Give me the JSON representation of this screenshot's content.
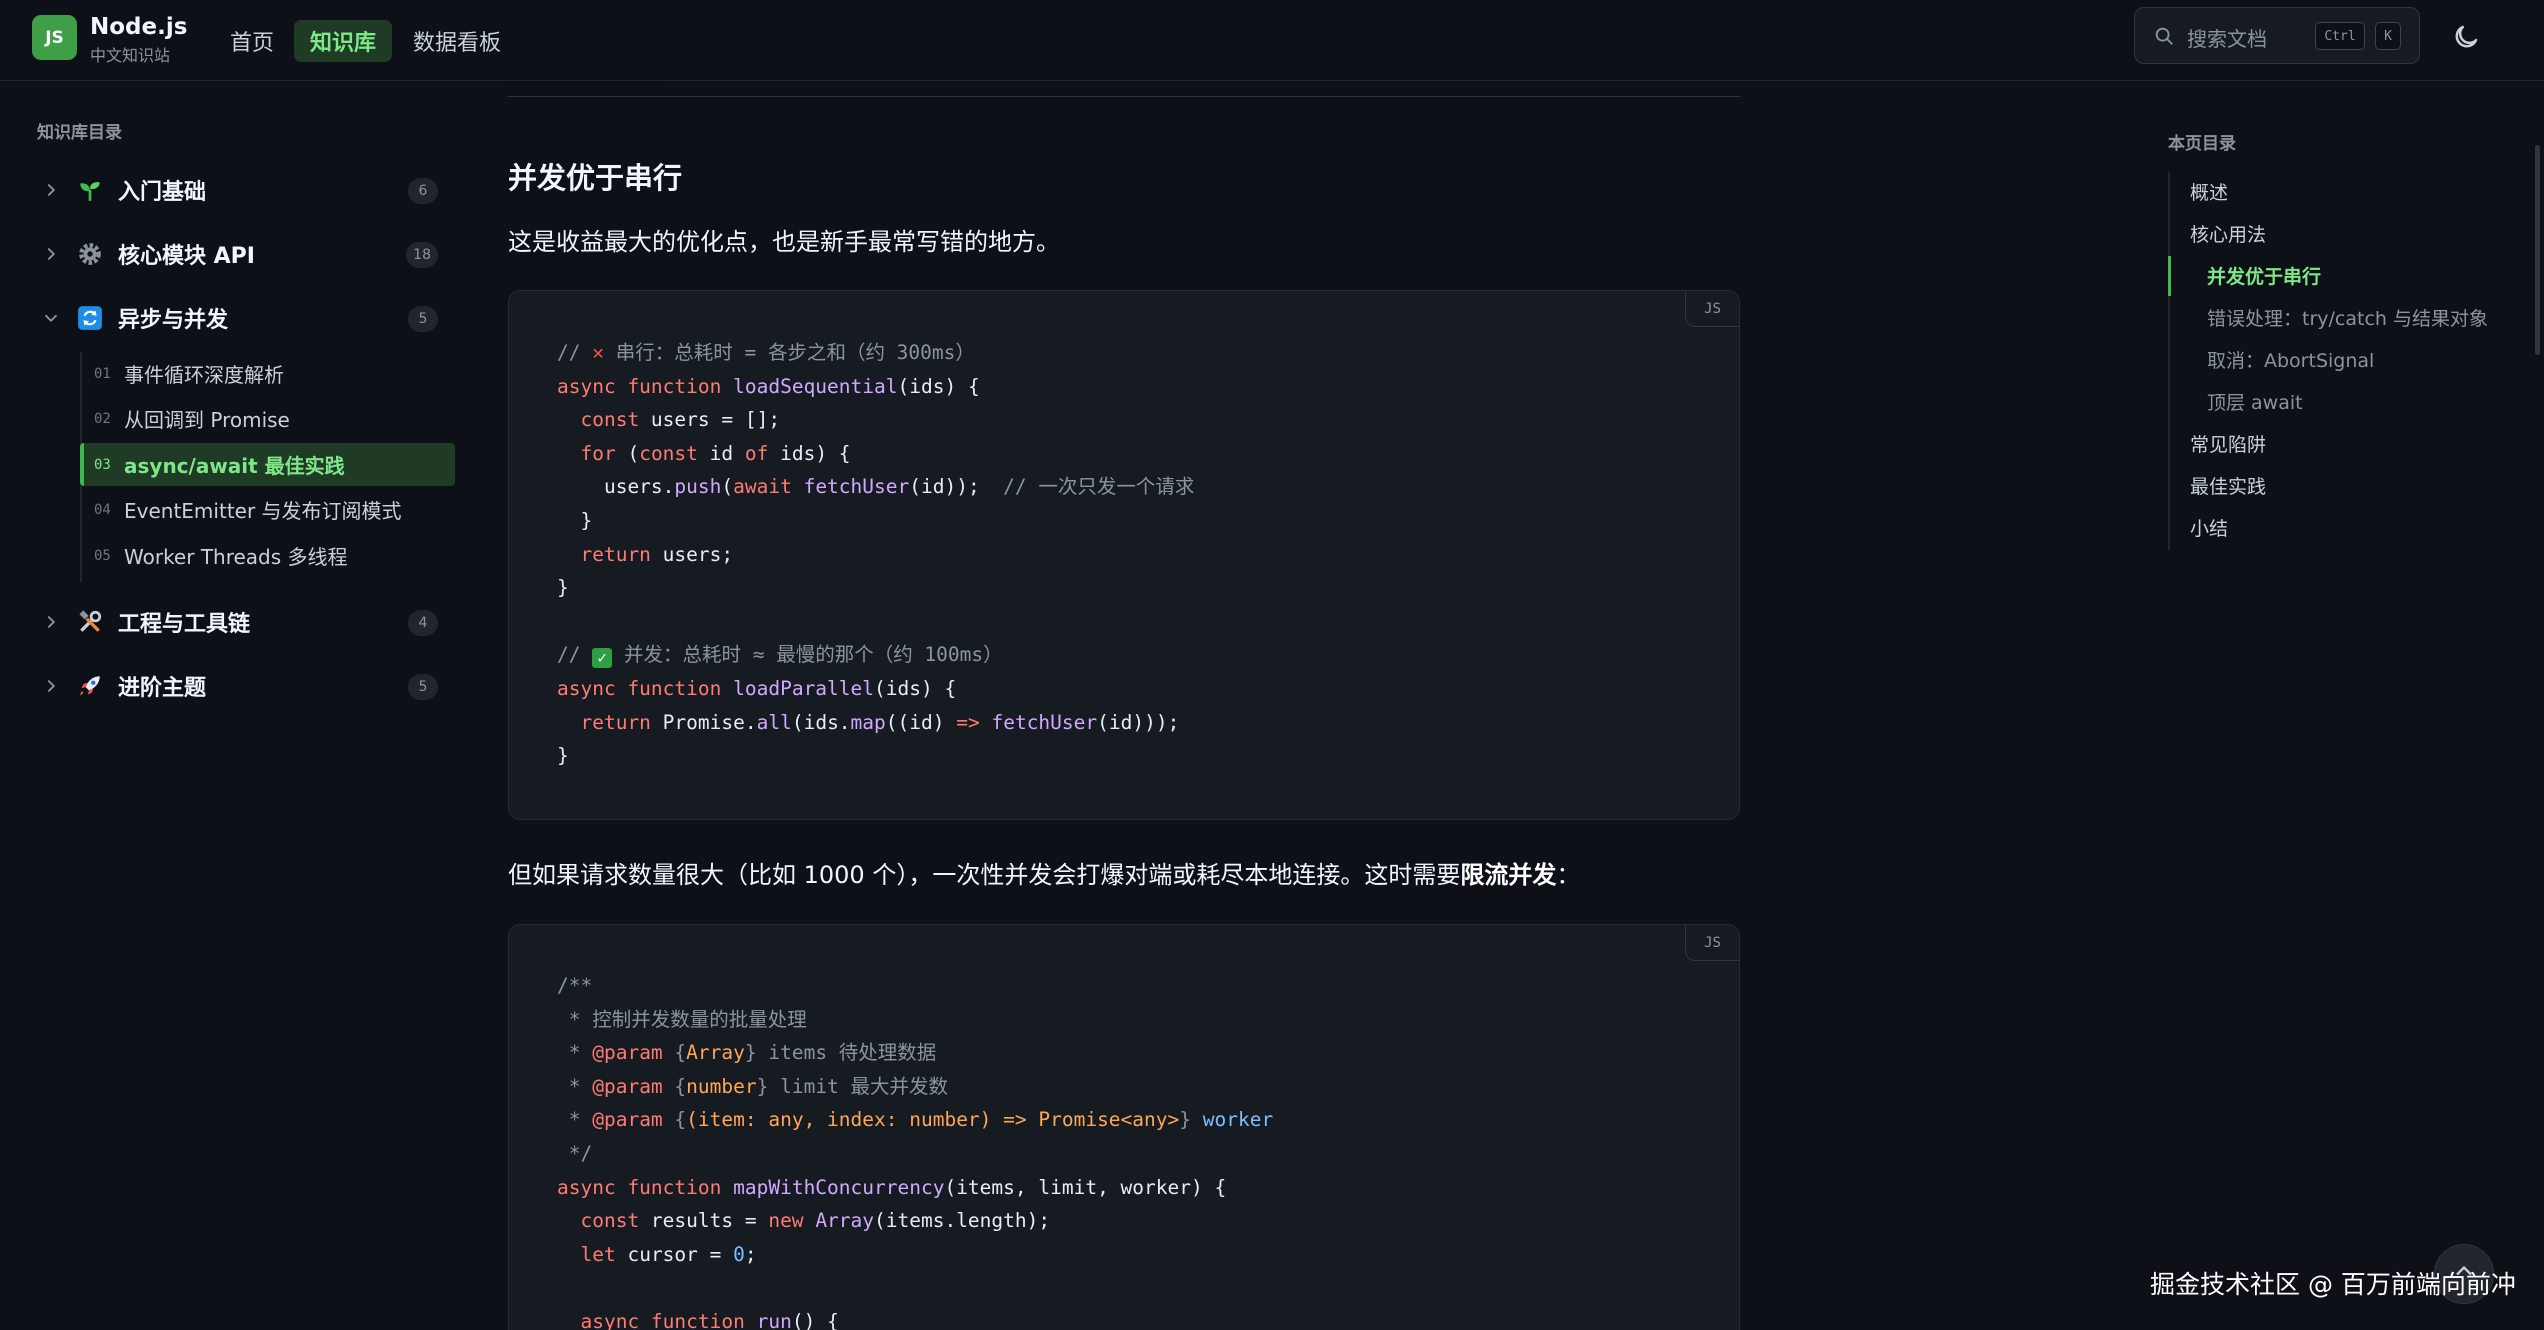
{
  "header": {
    "logo_badge": "JS",
    "logo_title": "Node.js",
    "logo_sub": "中文知识站",
    "nav": [
      {
        "label": "首页",
        "active": false
      },
      {
        "label": "知识库",
        "active": true
      },
      {
        "label": "数据看板",
        "active": false
      }
    ],
    "search_placeholder": "搜索文档",
    "shortcut_keys": [
      "Ctrl",
      "K"
    ],
    "theme_icon": "moon-icon"
  },
  "sidebar": {
    "title": "知识库目录",
    "sections": [
      {
        "label": "入门基础",
        "count": "6",
        "icon": "seedling-icon",
        "expanded": false
      },
      {
        "label": "核心模块 API",
        "count": "18",
        "icon": "gear-icon",
        "expanded": false
      },
      {
        "label": "异步与并发",
        "count": "5",
        "icon": "refresh-icon",
        "expanded": true,
        "items": [
          {
            "num": "01",
            "label": "事件循环深度解析"
          },
          {
            "num": "02",
            "label": "从回调到 Promise"
          },
          {
            "num": "03",
            "label": "async/await 最佳实践",
            "active": true
          },
          {
            "num": "04",
            "label": "EventEmitter 与发布订阅模式"
          },
          {
            "num": "05",
            "label": "Worker Threads 多线程"
          }
        ]
      },
      {
        "label": "工程与工具链",
        "count": "4",
        "icon": "tools-icon",
        "expanded": false
      },
      {
        "label": "进阶主题",
        "count": "5",
        "icon": "rocket-icon",
        "expanded": false
      }
    ]
  },
  "main": {
    "heading": "并发优于串行",
    "intro": "这是收益最大的优化点，也是新手最常写错的地方。",
    "code1_lang": "JS",
    "para2_before": "但如果请求数量很大（比如 1000 个），一次性并发会打爆对端或耗尽本地连接。这时需要",
    "para2_bold": "限流并发",
    "para2_after": "：",
    "code2_lang": "JS"
  },
  "toc": {
    "title": "本页目录",
    "items": [
      {
        "label": "概述",
        "level": 1
      },
      {
        "label": "核心用法",
        "level": 1
      },
      {
        "label": "并发优于串行",
        "level": 2,
        "active": true
      },
      {
        "label": "错误处理：try/catch 与结果对象",
        "level": 2
      },
      {
        "label": "取消：AbortSignal",
        "level": 2
      },
      {
        "label": "顶层 await",
        "level": 2
      },
      {
        "label": "常见陷阱",
        "level": 1
      },
      {
        "label": "最佳实践",
        "level": 1
      },
      {
        "label": "小结",
        "level": 1
      }
    ]
  },
  "watermark": "掘金技术社区 @ 百万前端向前冲",
  "colors": {
    "accent": "#3fb950",
    "accent_bg": "#1f3a25",
    "bg": "#0d1117",
    "code_bg": "#161b22"
  }
}
